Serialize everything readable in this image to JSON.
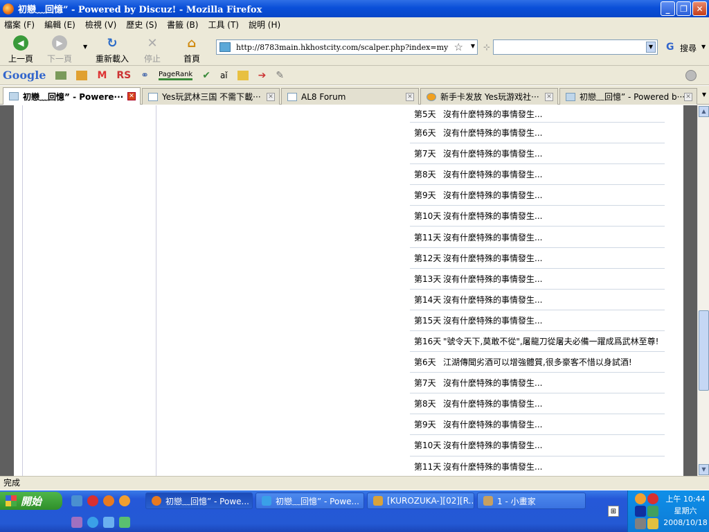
{
  "window": {
    "title": "初戀﹏回憶” - Powered by Discuz! - Mozilla Firefox"
  },
  "menu": [
    "檔案 (F)",
    "編輯 (E)",
    "檢視 (V)",
    "歷史 (S)",
    "書籤 (B)",
    "工具 (T)",
    "說明 (H)"
  ],
  "nav": {
    "back": "上一頁",
    "forward": "下一頁",
    "reload": "重新載入",
    "stop": "停止",
    "home": "首頁"
  },
  "url": "http://8783main.hkhostcity.com/scalper.php?index=my",
  "search": {
    "label": "搜尋",
    "engine_letter": "G"
  },
  "googlebar": {
    "logo": "Google",
    "rs": "RS",
    "pagerank": "PageRank"
  },
  "tabs": [
    "初戀﹏回憶” - Powere···",
    "Yes玩武林三国 不需下載···",
    "AL8 Forum",
    "新手卡发放 Yes玩游戏社···",
    "初戀﹏回憶” - Powered b···"
  ],
  "log": [
    {
      "day": "第5天",
      "text": "沒有什麼特殊的事情發生..."
    },
    {
      "day": "第6天",
      "text": "沒有什麼特殊的事情發生..."
    },
    {
      "day": "第7天",
      "text": "沒有什麼特殊的事情發生..."
    },
    {
      "day": "第8天",
      "text": "沒有什麼特殊的事情發生..."
    },
    {
      "day": "第9天",
      "text": "沒有什麼特殊的事情發生..."
    },
    {
      "day": "第10天",
      "text": "沒有什麼特殊的事情發生..."
    },
    {
      "day": "第11天",
      "text": "沒有什麼特殊的事情發生..."
    },
    {
      "day": "第12天",
      "text": "沒有什麼特殊的事情發生..."
    },
    {
      "day": "第13天",
      "text": "沒有什麼特殊的事情發生..."
    },
    {
      "day": "第14天",
      "text": "沒有什麼特殊的事情發生..."
    },
    {
      "day": "第15天",
      "text": "沒有什麼特殊的事情發生..."
    },
    {
      "day": "第16天",
      "text": "\"號令天下,莫敢不從\",屠龍刀從屠夫必備一躍成爲武林至尊!"
    },
    {
      "day": "第6天",
      "text": "江湖傳聞劣酒可以增強體質,很多豪客不惜以身試酒!"
    },
    {
      "day": "第7天",
      "text": "沒有什麼特殊的事情發生..."
    },
    {
      "day": "第8天",
      "text": "沒有什麼特殊的事情發生..."
    },
    {
      "day": "第9天",
      "text": "沒有什麼特殊的事情發生..."
    },
    {
      "day": "第10天",
      "text": "沒有什麼特殊的事情發生..."
    },
    {
      "day": "第11天",
      "text": "沒有什麼特殊的事情發生..."
    }
  ],
  "status": "完成",
  "taskbar": {
    "start": "開始",
    "tasks": [
      "初戀﹏回憶” - Powe...",
      "初戀﹏回憶” - Powe...",
      "[KUROZUKA-][02][R...",
      "1 - 小畫家"
    ],
    "time": "上午 10:44",
    "weekday": "星期六",
    "date": "2008/10/18"
  }
}
